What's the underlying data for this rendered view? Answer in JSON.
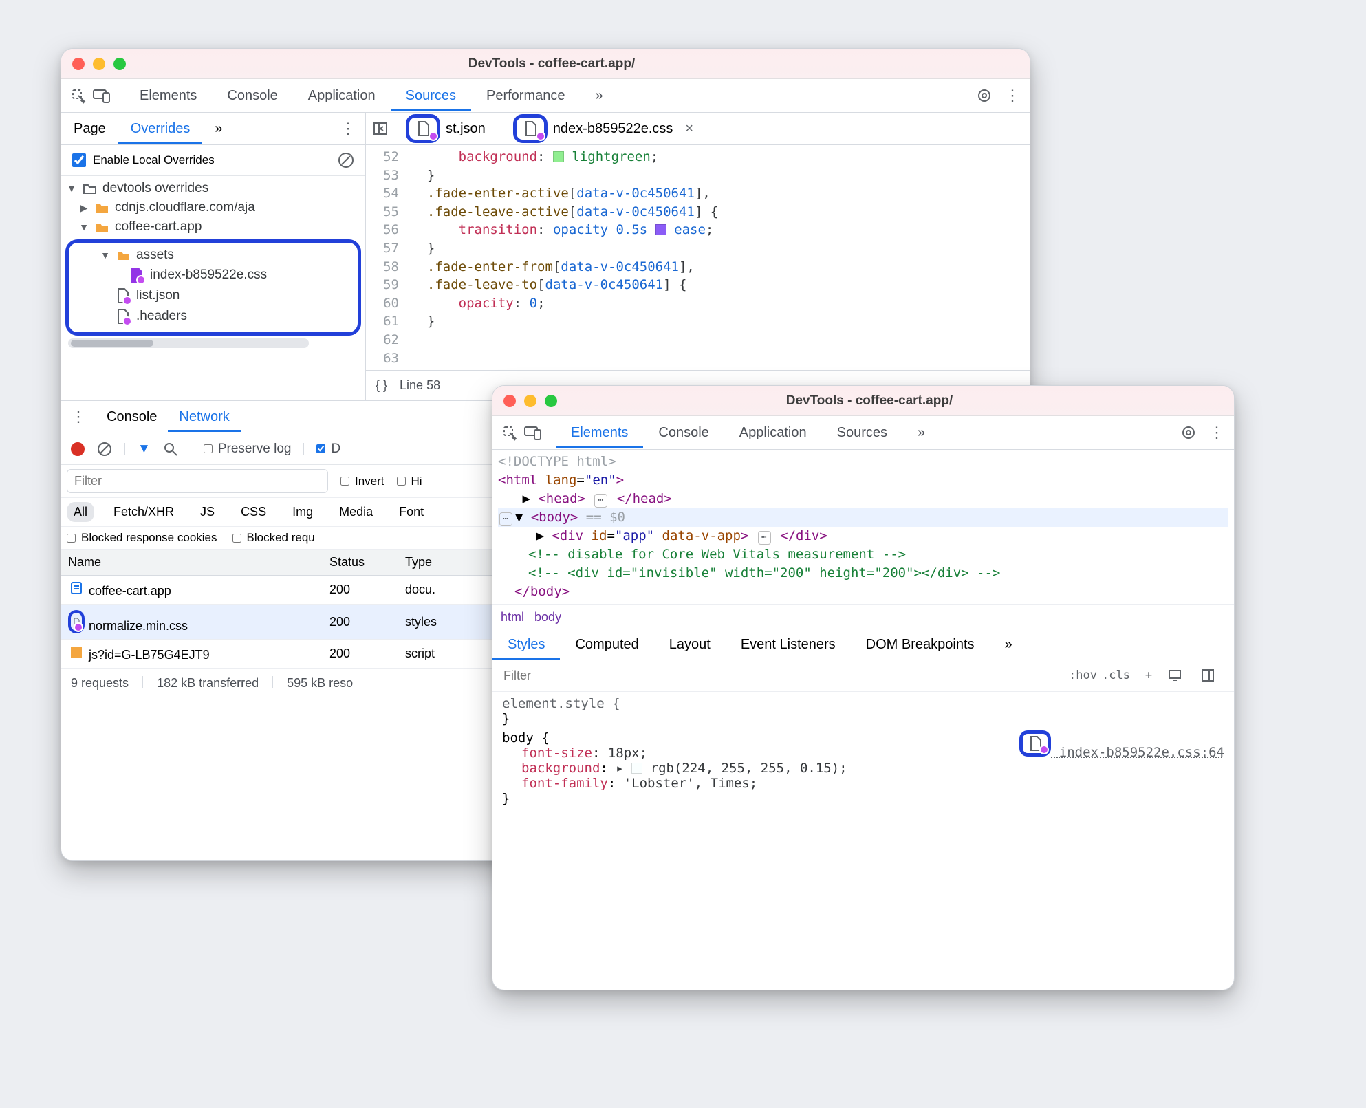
{
  "left": {
    "title": "DevTools - coffee-cart.app/",
    "tabs": [
      "Elements",
      "Console",
      "Application",
      "Sources",
      "Performance"
    ],
    "active_tab": "Sources",
    "sub_tabs": [
      "Page",
      "Overrides"
    ],
    "active_sub_tab": "Overrides",
    "enable_label": "Enable Local Overrides",
    "tree": {
      "root": "devtools overrides",
      "items": [
        "cdnjs.cloudflare.com/aja",
        "coffee-cart.app",
        "assets",
        "index-b859522e.css",
        "list.json",
        ".headers"
      ]
    },
    "editor_tabs": {
      "file1": "st.json",
      "file2": "ndex-b859522e.css"
    },
    "code": [
      {
        "n": "52",
        "html": "      <span class='tok-sel'>background</span><span class='tok-punct'>:</span> <span class='swatch' style='background:#90ee90'></span> <span class='tok-str'>lightgreen</span><span class='tok-punct'>;</span>"
      },
      {
        "n": "53",
        "html": "  <span class='tok-punct'>}</span>"
      },
      {
        "n": "54",
        "html": "  <span class='tok-obj'>.fade-enter-active</span><span class='tok-punct'>[</span><span class='tok-attr'>data-v-0c450641</span><span class='tok-punct'>],</span>"
      },
      {
        "n": "55",
        "html": "  <span class='tok-obj'>.fade-leave-active</span><span class='tok-punct'>[</span><span class='tok-attr'>data-v-0c450641</span><span class='tok-punct'>] {</span>"
      },
      {
        "n": "56",
        "html": "      <span class='tok-sel'>transition</span><span class='tok-punct'>:</span> <span class='tok-attr'>opacity</span> <span class='tok-num'>0.5s</span> <span class='swatch' style='background:#8b5cf6'></span> <span class='tok-attr'>ease</span><span class='tok-punct'>;</span>"
      },
      {
        "n": "57",
        "html": "  <span class='tok-punct'>}</span>"
      },
      {
        "n": "58",
        "html": "  <span class='tok-obj'>.fade-enter-from</span><span class='tok-punct'>[</span><span class='tok-attr'>data-v-0c450641</span><span class='tok-punct'>],</span>"
      },
      {
        "n": "59",
        "html": "  <span class='tok-obj'>.fade-leave-to</span><span class='tok-punct'>[</span><span class='tok-attr'>data-v-0c450641</span><span class='tok-punct'>] {</span>"
      },
      {
        "n": "60",
        "html": "      <span class='tok-sel'>opacity</span><span class='tok-punct'>:</span> <span class='tok-num'>0</span><span class='tok-punct'>;</span>"
      },
      {
        "n": "61",
        "html": "  <span class='tok-punct'>}</span>"
      },
      {
        "n": "62",
        "html": ""
      },
      {
        "n": "63",
        "html": ""
      }
    ],
    "status": {
      "line": "Line 58"
    },
    "drawer": {
      "tabs": [
        "Console",
        "Network"
      ],
      "active": "Network",
      "toolbar_labels": {
        "preserve": "Preserve log",
        "disable_cache": "D"
      },
      "filter_placeholder": "Filter",
      "invert_label": "Invert",
      "hide_label": "Hi",
      "types": [
        "All",
        "Fetch/XHR",
        "JS",
        "CSS",
        "Img",
        "Media",
        "Font"
      ],
      "active_type": "All",
      "blocked_cookies_label": "Blocked response cookies",
      "blocked_requests_label": "Blocked requ",
      "columns": [
        "Name",
        "Status",
        "Type"
      ],
      "rows": [
        {
          "name": "coffee-cart.app",
          "status": "200",
          "type": "docu.",
          "icon": "doc"
        },
        {
          "name": "normalize.min.css",
          "status": "200",
          "type": "styles",
          "icon": "override",
          "selected": true
        },
        {
          "name": "js?id=G-LB75G4EJT9",
          "status": "200",
          "type": "script",
          "icon": "js"
        }
      ],
      "footer": {
        "requests": "9 requests",
        "transferred": "182 kB transferred",
        "resources": "595 kB reso"
      }
    }
  },
  "right": {
    "title": "DevTools - coffee-cart.app/",
    "tabs": [
      "Elements",
      "Console",
      "Application",
      "Sources"
    ],
    "active_tab": "Elements",
    "dom": {
      "doctype": "<!DOCTYPE html>",
      "html_open": "<html lang=\"en\">",
      "head": "<head> … </head>",
      "body_open": "<body>",
      "eqzero": " == $0",
      "div": "<div id=\"app\" data-v-app> … </div>",
      "c1": "<!-- disable for Core Web Vitals measurement -->",
      "c2": "<!-- <div id=\"invisible\" width=\"200\" height=\"200\"></div> -->",
      "body_close": "</body>"
    },
    "crumbs": [
      "html",
      "body"
    ],
    "styles_tabs": [
      "Styles",
      "Computed",
      "Layout",
      "Event Listeners",
      "DOM Breakpoints"
    ],
    "active_styles_tab": "Styles",
    "filter_placeholder": "Filter",
    "style_tools": [
      ":hov",
      ".cls",
      "+"
    ],
    "elstyle_label": "element.style {",
    "body_label": "body {",
    "rule_src": "index-b859522e.css:64",
    "props": {
      "font_size": {
        "k": "font-size",
        "v": "18px;"
      },
      "background": {
        "k": "background",
        "v_prefix": "▸ ",
        "v": "rgb(224, 255, 255, 0.15);"
      },
      "font_family": {
        "k": "font-family",
        "v": "'Lobster', Times;"
      }
    },
    "close_brace": "}"
  }
}
